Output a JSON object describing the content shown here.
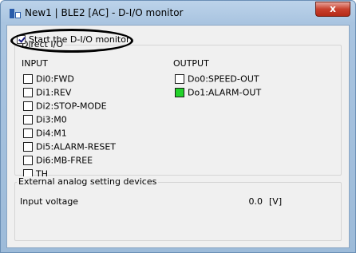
{
  "window": {
    "title": "New1 | BLE2 [AC] - D-I/O monitor",
    "close_glyph": "x"
  },
  "monitor": {
    "checkbox_label": "Start the D-I/O monitor",
    "checked": true
  },
  "direct_io": {
    "legend": "Direct I/O",
    "input_title": "INPUT",
    "output_title": "OUTPUT",
    "inputs": [
      {
        "label": "Di0:FWD",
        "active": false
      },
      {
        "label": "Di1:REV",
        "active": false
      },
      {
        "label": "Di2:STOP-MODE",
        "active": false
      },
      {
        "label": "Di3:M0",
        "active": false
      },
      {
        "label": "Di4:M1",
        "active": false
      },
      {
        "label": "Di5:ALARM-RESET",
        "active": false
      },
      {
        "label": "Di6:MB-FREE",
        "active": false
      },
      {
        "label": "TH",
        "active": false
      }
    ],
    "outputs": [
      {
        "label": "Do0:SPEED-OUT",
        "active": false
      },
      {
        "label": "Do1:ALARM-OUT",
        "active": true
      }
    ]
  },
  "external_analog": {
    "legend": "External analog setting devices",
    "input_voltage_label": "Input voltage",
    "input_voltage_value": "0.0",
    "unit": "[V]"
  },
  "colors": {
    "active_indicator": "#22d22a",
    "close_button": "#c8402d"
  }
}
